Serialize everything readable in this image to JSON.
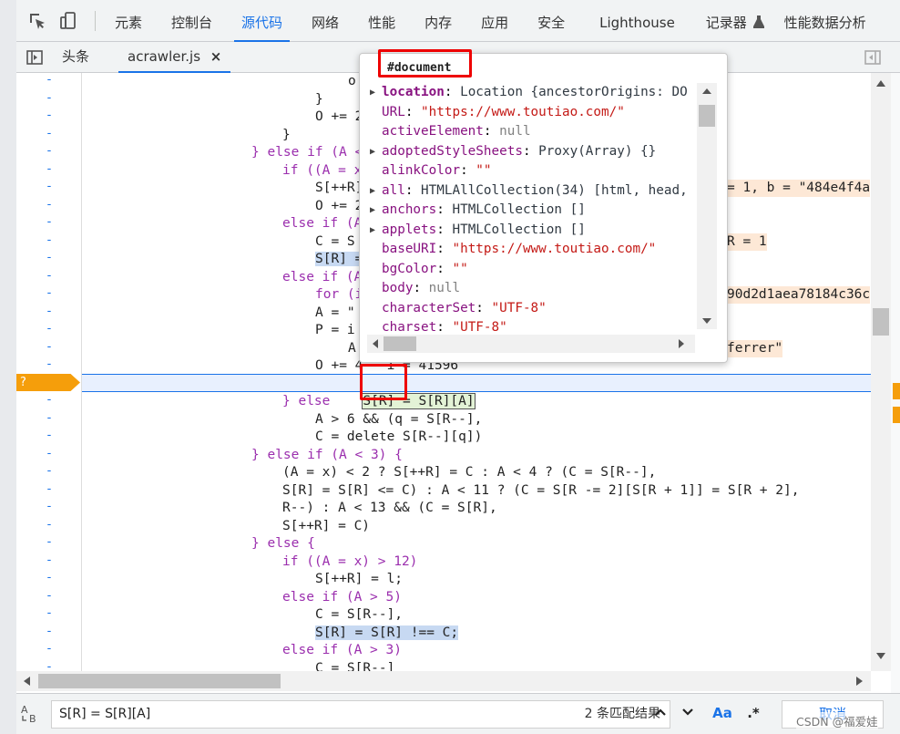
{
  "toolbar": {
    "tabs": [
      {
        "label": "元素"
      },
      {
        "label": "控制台"
      },
      {
        "label": "源代码"
      },
      {
        "label": "网络"
      },
      {
        "label": "性能"
      },
      {
        "label": "内存"
      },
      {
        "label": "应用"
      },
      {
        "label": "安全"
      },
      {
        "label": "Lighthouse"
      },
      {
        "label": "记录器"
      },
      {
        "label": "性能数据分析"
      }
    ],
    "active_tab": "源代码",
    "icons": [
      "inspect-element-icon",
      "device-toolbar-icon",
      "flask-icon"
    ]
  },
  "filebar": {
    "tabs": [
      {
        "label": "头条"
      },
      {
        "label": "acrawler.js"
      }
    ],
    "active_tab": "acrawler.js",
    "close_glyph": "×",
    "icons": [
      "toggle-navigator-icon",
      "toggle-debugger-icon"
    ]
  },
  "code": {
    "lines": [
      "o",
      "}",
      "O += 2",
      "}",
      "} else if (A < 8",
      "if ((A = x) > 6)",
      "S[++R]",
      "O += 2",
      "else if (A",
      "C = S",
      "S[R] =",
      "else if (A",
      "for (i",
      "A = \"",
      "P = i",
      "A",
      "O += 4   i = 41596",
      "S[R] = S[R][A]",
      "} else",
      "A > 6 && (q = S[R--],",
      "C = delete S[R--][q])",
      "} else if (A < 3) {",
      "(A = x) < 2 ? S[++R] = C : A < 4 ? (C = S[R--],",
      "S[R] = S[R] <= C) : A < 11 ? (C = S[R -= 2][S[R + 1]] = S[R + 2],",
      "R--) : A < 13 && (C = S[R],",
      "S[++R] = C)",
      "} else {",
      "if ((A = x) > 12)",
      "S[++R] = l;",
      "else if (A > 5)",
      "C = S[R--],",
      "S[R] = S[R] !== C;",
      "else if (A > 3)",
      "C = S[R--]"
    ],
    "ghost_values": [
      "= 1, b = \"484e4f4a",
      "R = 1",
      "90d2d1aea78184c36c",
      "ferrer\""
    ],
    "breakpoint_marker": "?",
    "gutter_mark": "-"
  },
  "popover": {
    "title": "#document",
    "rows": [
      {
        "key": "location",
        "value": "Location {ancestorOrigins: DO",
        "expandable": true,
        "bold": true,
        "kind": "obj"
      },
      {
        "key": "URL",
        "value": "\"https://www.toutiao.com/\"",
        "expandable": false,
        "kind": "str"
      },
      {
        "key": "activeElement",
        "value": "null",
        "expandable": false,
        "kind": "null"
      },
      {
        "key": "adoptedStyleSheets",
        "value": "Proxy(Array) {}",
        "expandable": true,
        "kind": "obj"
      },
      {
        "key": "alinkColor",
        "value": "\"\"",
        "expandable": false,
        "kind": "str"
      },
      {
        "key": "all",
        "value": "HTMLAllCollection(34) [html, head,",
        "expandable": true,
        "kind": "obj"
      },
      {
        "key": "anchors",
        "value": "HTMLCollection []",
        "expandable": true,
        "kind": "obj"
      },
      {
        "key": "applets",
        "value": "HTMLCollection []",
        "expandable": true,
        "kind": "obj"
      },
      {
        "key": "baseURI",
        "value": "\"https://www.toutiao.com/\"",
        "expandable": false,
        "kind": "str"
      },
      {
        "key": "bgColor",
        "value": "\"\"",
        "expandable": false,
        "kind": "str"
      },
      {
        "key": "body",
        "value": "null",
        "expandable": false,
        "kind": "null"
      },
      {
        "key": "characterSet",
        "value": "\"UTF-8\"",
        "expandable": false,
        "kind": "str"
      },
      {
        "key": "charset",
        "value": "\"UTF-8\"",
        "expandable": false,
        "kind": "str"
      }
    ]
  },
  "search": {
    "value": "S[R] = S[R][A]",
    "result_count": "2 条匹配结果",
    "case_label": "Aa",
    "regex_label": ".*",
    "cancel_label": "取消",
    "watermark": "CSDN @福爱娃"
  },
  "colors": {
    "accent": "#1a73e8",
    "annotation_red": "#e00000",
    "breakpoint_orange": "#f59e0b"
  }
}
